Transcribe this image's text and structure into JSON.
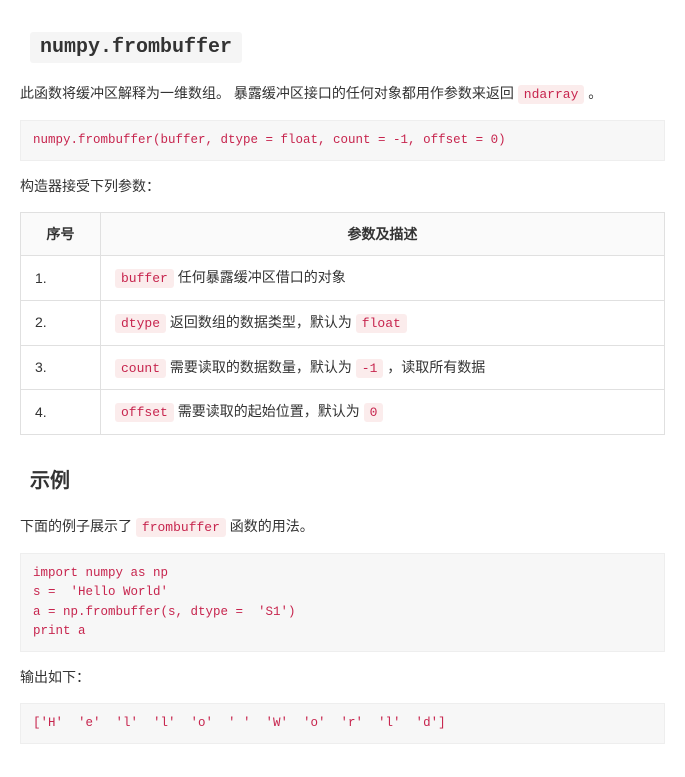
{
  "heading": "numpy.frombuffer",
  "intro": {
    "pre1": "此函数将缓冲区解释为一维数组。 暴露缓冲区接口的任何对象都用作参数来返回 ",
    "code": "ndarray",
    "post1": " 。"
  },
  "signature": "numpy.frombuffer(buffer, dtype = float, count = -1, offset = 0)",
  "params_intro": "构造器接受下列参数：",
  "table": {
    "col1": "序号",
    "col2": "参数及描述",
    "rows": [
      {
        "n": "1.",
        "name": "buffer",
        "desc_pre": "",
        "desc_post": " 任何暴露缓冲区借口的对象",
        "code2": "",
        "tail": ""
      },
      {
        "n": "2.",
        "name": "dtype",
        "desc_pre": "",
        "desc_post": " 返回数组的数据类型，默认为 ",
        "code2": "float",
        "tail": ""
      },
      {
        "n": "3.",
        "name": "count",
        "desc_pre": "",
        "desc_post": " 需要读取的数据数量，默认为 ",
        "code2": "-1",
        "tail": " ，读取所有数据"
      },
      {
        "n": "4.",
        "name": "offset",
        "desc_pre": "",
        "desc_post": " 需要读取的起始位置，默认为 ",
        "code2": "0",
        "tail": ""
      }
    ]
  },
  "example_heading": "示例",
  "example_intro_pre": "下面的例子展示了 ",
  "example_intro_code": "frombuffer",
  "example_intro_post": " 函数的用法。",
  "example_code": "import numpy as np \ns =  'Hello World' \na = np.frombuffer(s, dtype =  'S1')  \nprint a",
  "output_label": "输出如下：",
  "output_code": "['H'  'e'  'l'  'l'  'o'  ' '  'W'  'o'  'r'  'l'  'd']"
}
